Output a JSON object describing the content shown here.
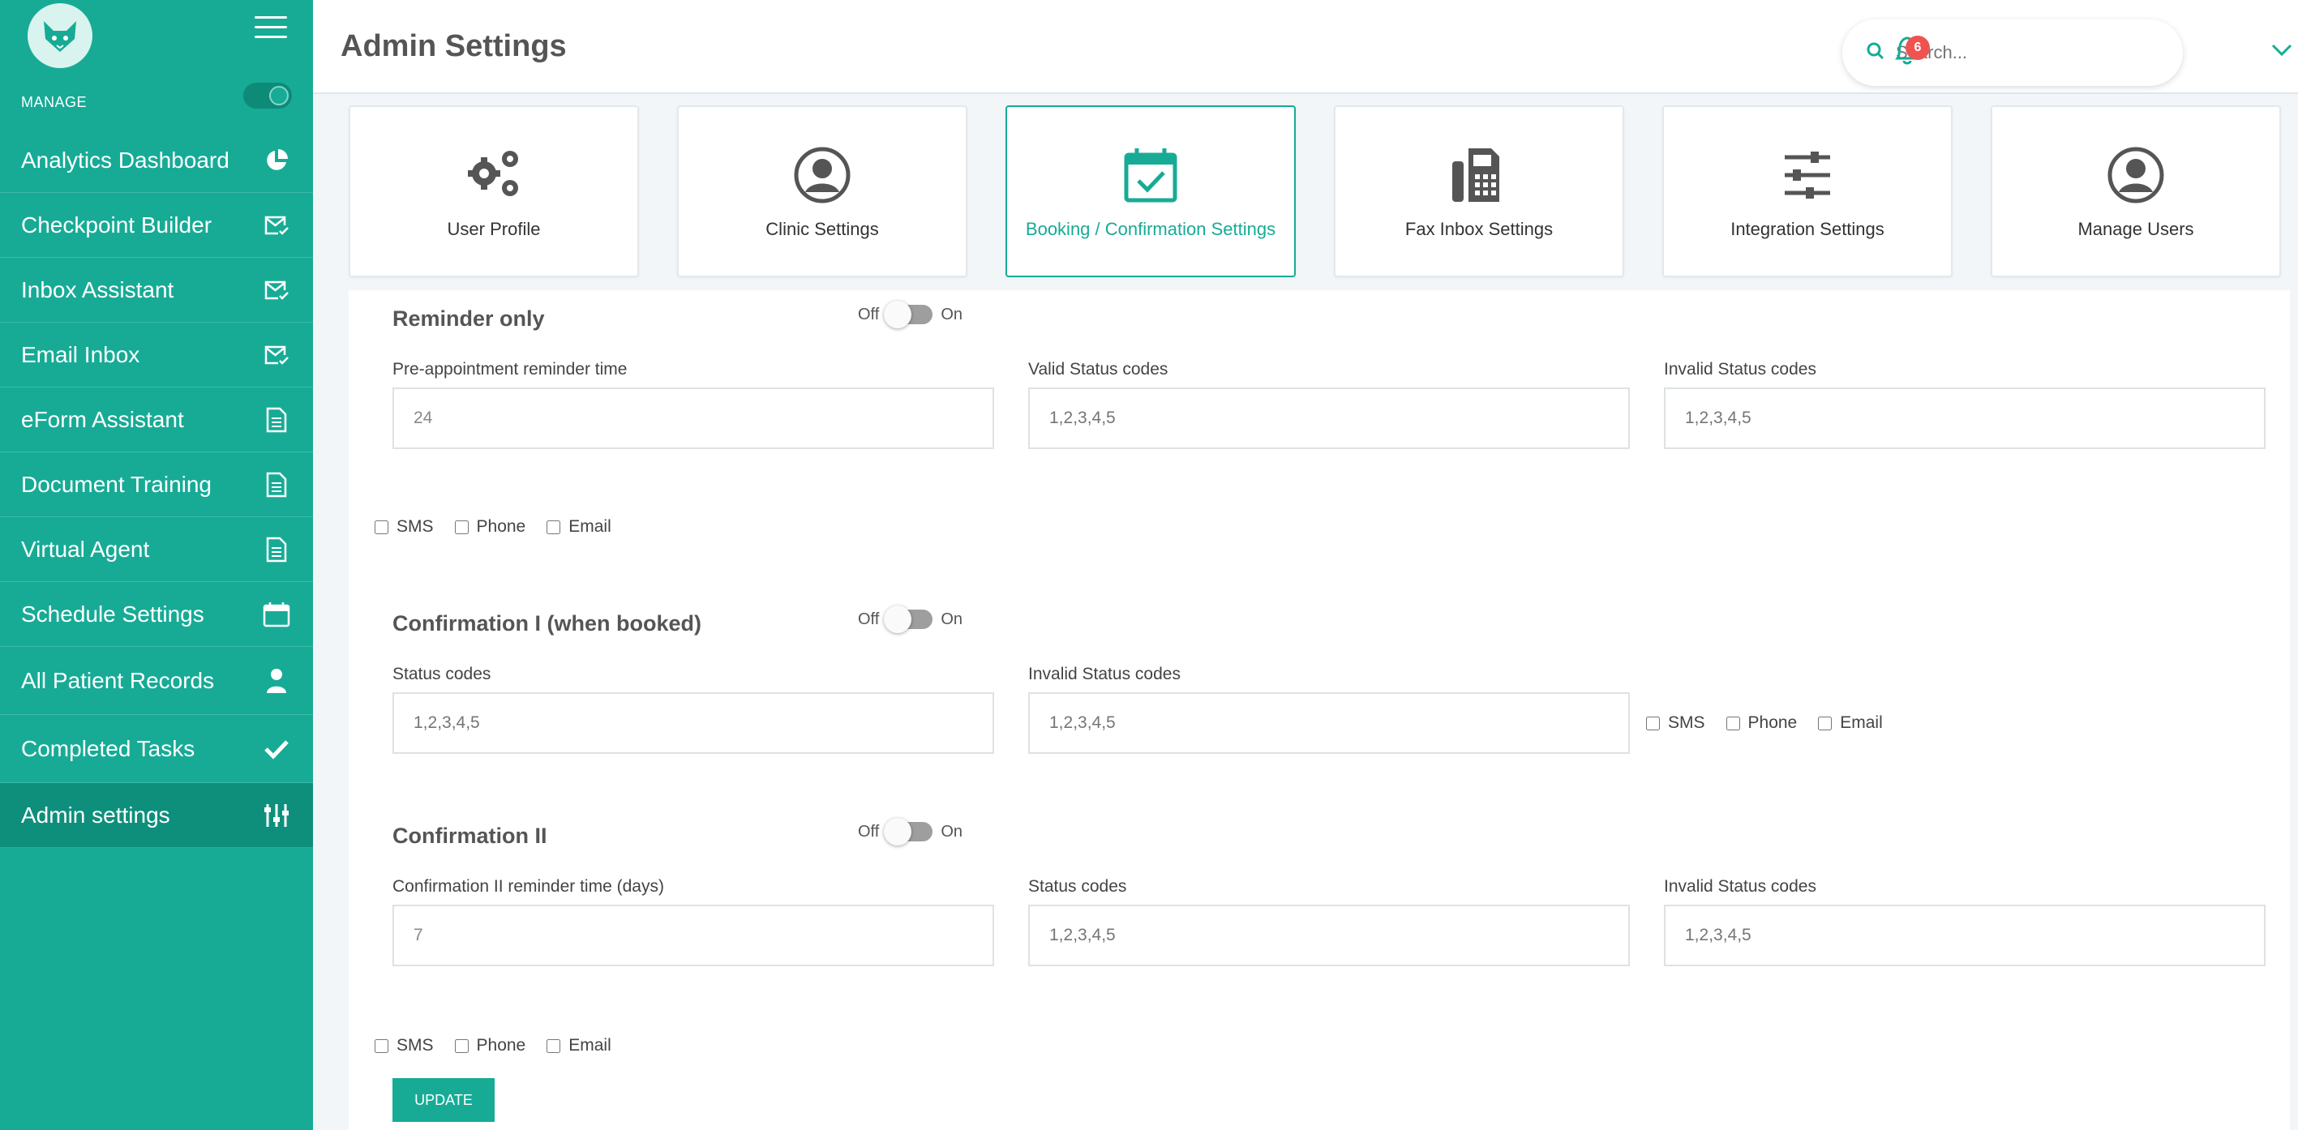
{
  "sidebar": {
    "manage_label": "MANAGE",
    "items": [
      {
        "label": "Analytics Dashboard",
        "icon": "pie-chart-icon"
      },
      {
        "label": "Checkpoint Builder",
        "icon": "mail-check-icon"
      },
      {
        "label": "Inbox Assistant",
        "icon": "mail-check-icon"
      },
      {
        "label": "Email Inbox",
        "icon": "mail-check-icon"
      },
      {
        "label": "eForm Assistant",
        "icon": "document-icon"
      },
      {
        "label": "Document Training",
        "icon": "document-icon"
      },
      {
        "label": "Virtual Agent",
        "icon": "document-icon"
      },
      {
        "label": "Schedule Settings",
        "icon": "calendar-icon"
      },
      {
        "label": "All Patient Records",
        "icon": "user-icon"
      },
      {
        "label": "Completed Tasks",
        "icon": "checkmark-icon"
      },
      {
        "label": "Admin settings",
        "icon": "sliders-icon"
      }
    ]
  },
  "header": {
    "title": "Admin Settings",
    "search_placeholder": "Search...",
    "notification_count": "6"
  },
  "tiles": [
    {
      "label": "User Profile",
      "icon": "gears-icon"
    },
    {
      "label": "Clinic Settings",
      "icon": "user-circle-icon"
    },
    {
      "label": "Booking / Confirmation Settings",
      "icon": "calendar-check-icon"
    },
    {
      "label": "Fax Inbox Settings",
      "icon": "fax-icon"
    },
    {
      "label": "Integration Settings",
      "icon": "sliders-icon"
    },
    {
      "label": "Manage Users",
      "icon": "user-circle-icon"
    }
  ],
  "toggle": {
    "off": "Off",
    "on": "On"
  },
  "channels": {
    "sms": "SMS",
    "phone": "Phone",
    "email": "Email"
  },
  "reminder": {
    "title": "Reminder only",
    "pre_label": "Pre-appointment reminder time",
    "pre_value": "24",
    "valid_label": "Valid Status codes",
    "valid_placeholder": "1,2,3,4,5",
    "invalid_label": "Invalid Status codes",
    "invalid_placeholder": "1,2,3,4,5"
  },
  "confirmation1": {
    "title": "Confirmation I (when booked)",
    "status_label": "Status codes",
    "status_placeholder": "1,2,3,4,5",
    "invalid_label": "Invalid Status codes",
    "invalid_placeholder": "1,2,3,4,5"
  },
  "confirmation2": {
    "title": "Confirmation II",
    "time_label": "Confirmation II reminder time (days)",
    "time_value": "7",
    "status_label": "Status codes",
    "status_placeholder": "1,2,3,4,5",
    "invalid_label": "Invalid Status codes",
    "invalid_placeholder": "1,2,3,4,5"
  },
  "update_label": "UPDATE",
  "colors": {
    "accent": "#17ab96",
    "accent_dark": "#0e8f7c",
    "badge": "#ef5350"
  }
}
